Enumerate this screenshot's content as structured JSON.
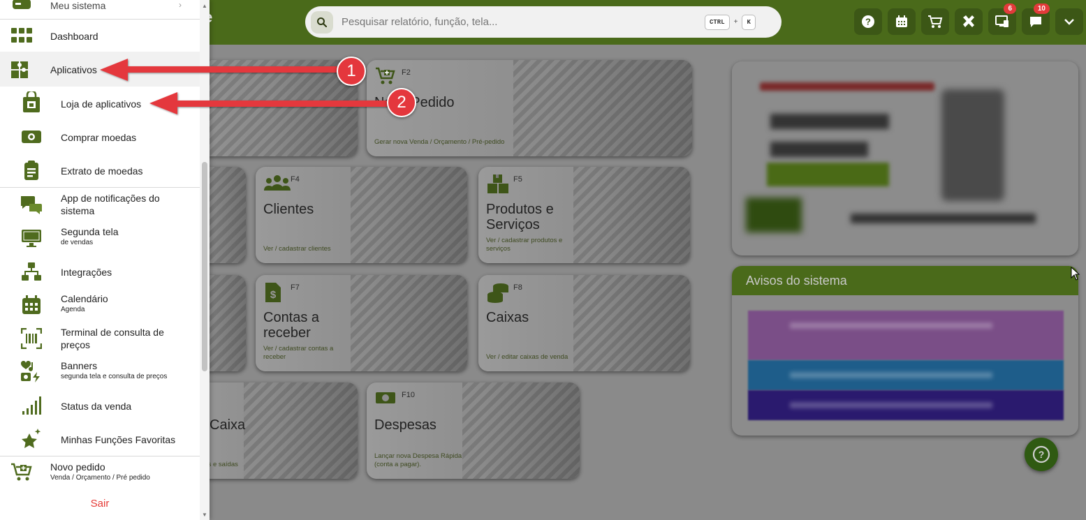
{
  "topbar": {
    "logo_fragment": "e",
    "search_placeholder": "Pesquisar relatório, função, tela...",
    "shortcut_key1": "CTRL",
    "shortcut_plus": "+",
    "shortcut_key2": "K",
    "buttons": [
      {
        "icon": "help-icon"
      },
      {
        "icon": "calendar-icon"
      },
      {
        "icon": "cart-icon"
      },
      {
        "icon": "tools-icon"
      },
      {
        "icon": "monitor-icon",
        "badge": "6"
      },
      {
        "icon": "chat-icon",
        "badge": "10"
      },
      {
        "icon": "chevron-down-icon"
      }
    ]
  },
  "sidebar": {
    "meu_sistema": "Meu sistema",
    "dashboard": "Dashboard",
    "aplicativos": "Aplicativos",
    "loja": "Loja de aplicativos",
    "comprar": "Comprar moedas",
    "extrato": "Extrato de moedas",
    "app_notif": "App de notificações do sistema",
    "segunda_tela": "Segunda tela",
    "segunda_tela_sub": "de vendas",
    "integracoes": "Integrações",
    "calendario": "Calendário",
    "calendario_sub": "Agenda",
    "terminal": "Terminal de consulta de preços",
    "banners": "Banners",
    "banners_sub": "segunda tela e consulta de preços",
    "status": "Status da venda",
    "favoritas": "Minhas Funções Favoritas",
    "novo_pedido": "Novo pedido",
    "novo_pedido_sub": "Venda / Orçamento / Pré pedido",
    "sair": "Sair"
  },
  "cards": {
    "novo": {
      "key": "F2",
      "title": "Novo Pedido",
      "sub": "Gerar nova Venda / Orçamento / Pré-pedido"
    },
    "clientes": {
      "key": "F4",
      "title": "Clientes",
      "sub": "Ver / cadastrar clientes"
    },
    "produtos": {
      "key": "F5",
      "title": "Produtos e Serviços",
      "sub": "Ver / cadastrar produtos e serviços"
    },
    "contas": {
      "key": "F7",
      "title": "Contas a receber",
      "sub": "Ver / cadastrar contas a receber"
    },
    "caixas": {
      "key": "F8",
      "title": "Caixas",
      "sub": "Ver / editar caixas de venda"
    },
    "caixa": {
      "title": "Caixa",
      "sub": "das e saídas"
    },
    "despesas": {
      "key": "F10",
      "title": "Despesas",
      "sub": "Lançar nova Despesa Rápida (conta a pagar)."
    }
  },
  "avisos": {
    "title": "Avisos do sistema"
  },
  "annotations": {
    "step1": "1",
    "step2": "2"
  },
  "colors": {
    "brand_green": "#4a6a1a",
    "icon_green": "#4f6b1e",
    "arrow_red": "#e4373d",
    "sair_red": "#e53935"
  }
}
